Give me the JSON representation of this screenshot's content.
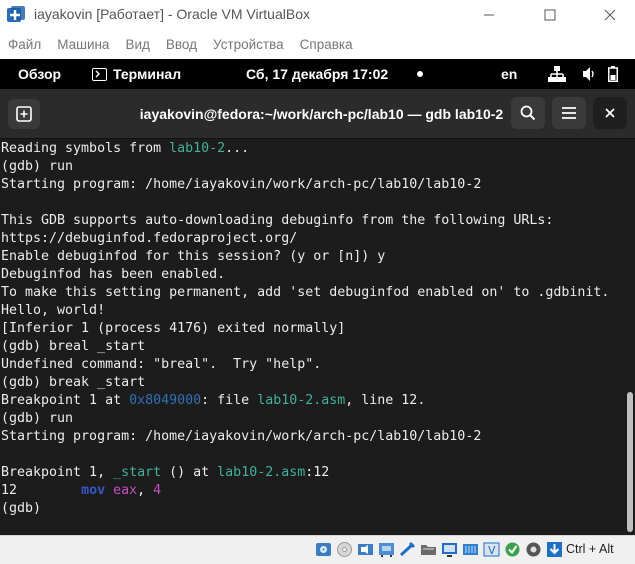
{
  "window": {
    "title": "iayakovin [Работает] - Oracle VM VirtualBox"
  },
  "menu": {
    "items": [
      "Файл",
      "Машина",
      "Вид",
      "Ввод",
      "Устройства",
      "Справка"
    ]
  },
  "gnome": {
    "overview_label": "Обзор",
    "app_label": "Терминал",
    "clock": "Сб, 17 декабря  17:02",
    "lang": "en"
  },
  "terminal": {
    "title": "iayakovin@fedora:~/work/arch-pc/lab10 — gdb lab10-2",
    "lines": [
      [
        {
          "t": "Reading symbols from "
        },
        {
          "t": "lab10-2",
          "c": "fname"
        },
        {
          "t": "..."
        }
      ],
      [
        {
          "t": "(gdb) run"
        }
      ],
      [
        {
          "t": "Starting program: /home/iayakovin/work/arch-pc/lab10/lab10-2"
        }
      ],
      [
        {
          "t": ""
        }
      ],
      [
        {
          "t": "This GDB supports auto-downloading debuginfo from the following URLs:"
        }
      ],
      [
        {
          "t": "https://debuginfod.fedoraproject.org/"
        }
      ],
      [
        {
          "t": "Enable debuginfod for this session? (y or [n]) y"
        }
      ],
      [
        {
          "t": "Debuginfod has been enabled."
        }
      ],
      [
        {
          "t": "To make this setting permanent, add 'set debuginfod enabled on' to .gdbinit."
        }
      ],
      [
        {
          "t": "Hello, world!"
        }
      ],
      [
        {
          "t": "[Inferior 1 (process 4176) exited normally]"
        }
      ],
      [
        {
          "t": "(gdb) breal _start"
        }
      ],
      [
        {
          "t": "Undefined command: \"breal\".  Try \"help\"."
        }
      ],
      [
        {
          "t": "(gdb) break _start"
        }
      ],
      [
        {
          "t": "Breakpoint 1 at "
        },
        {
          "t": "0x8049000",
          "c": "addr"
        },
        {
          "t": ": file "
        },
        {
          "t": "lab10-2.asm",
          "c": "fname"
        },
        {
          "t": ", line 12."
        }
      ],
      [
        {
          "t": "(gdb) run"
        }
      ],
      [
        {
          "t": "Starting program: /home/iayakovin/work/arch-pc/lab10/lab10-2"
        }
      ],
      [
        {
          "t": ""
        }
      ],
      [
        {
          "t": "Breakpoint 1, "
        },
        {
          "t": "_start",
          "c": "fname"
        },
        {
          "t": " () at "
        },
        {
          "t": "lab10-2.asm",
          "c": "fname"
        },
        {
          "t": ":12"
        }
      ],
      [
        {
          "t": "12        "
        },
        {
          "t": "mov",
          "c": "kw"
        },
        {
          "t": " "
        },
        {
          "t": "eax",
          "c": "reg"
        },
        {
          "t": ", "
        },
        {
          "t": "4",
          "c": "num"
        }
      ],
      [
        {
          "t": "(gdb) "
        }
      ]
    ]
  },
  "status": {
    "hostkey": "Ctrl + Alt"
  },
  "colors": {
    "gnome_bar": "#000000",
    "terminal_bg": "#1c1c1c",
    "filename": "#3db39a",
    "address": "#2f72b8",
    "keyword": "#3558c9",
    "register": "#c94bc4"
  }
}
